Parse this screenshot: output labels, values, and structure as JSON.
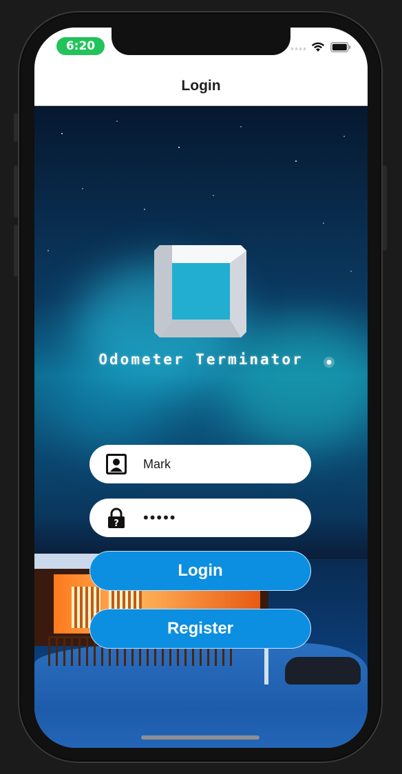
{
  "status_bar": {
    "time": "6:20"
  },
  "nav": {
    "title": "Login"
  },
  "app": {
    "name": "Odometer Terminator"
  },
  "login_form": {
    "username_value": "Mark",
    "password_value": "•••••",
    "login_label": "Login",
    "register_label": "Register"
  },
  "colors": {
    "primary_button": "#0c8fe0",
    "time_pill": "#21c35a"
  },
  "icons": {
    "username": "user-icon",
    "password": "lock-icon",
    "logo": "square-frame-logo"
  }
}
